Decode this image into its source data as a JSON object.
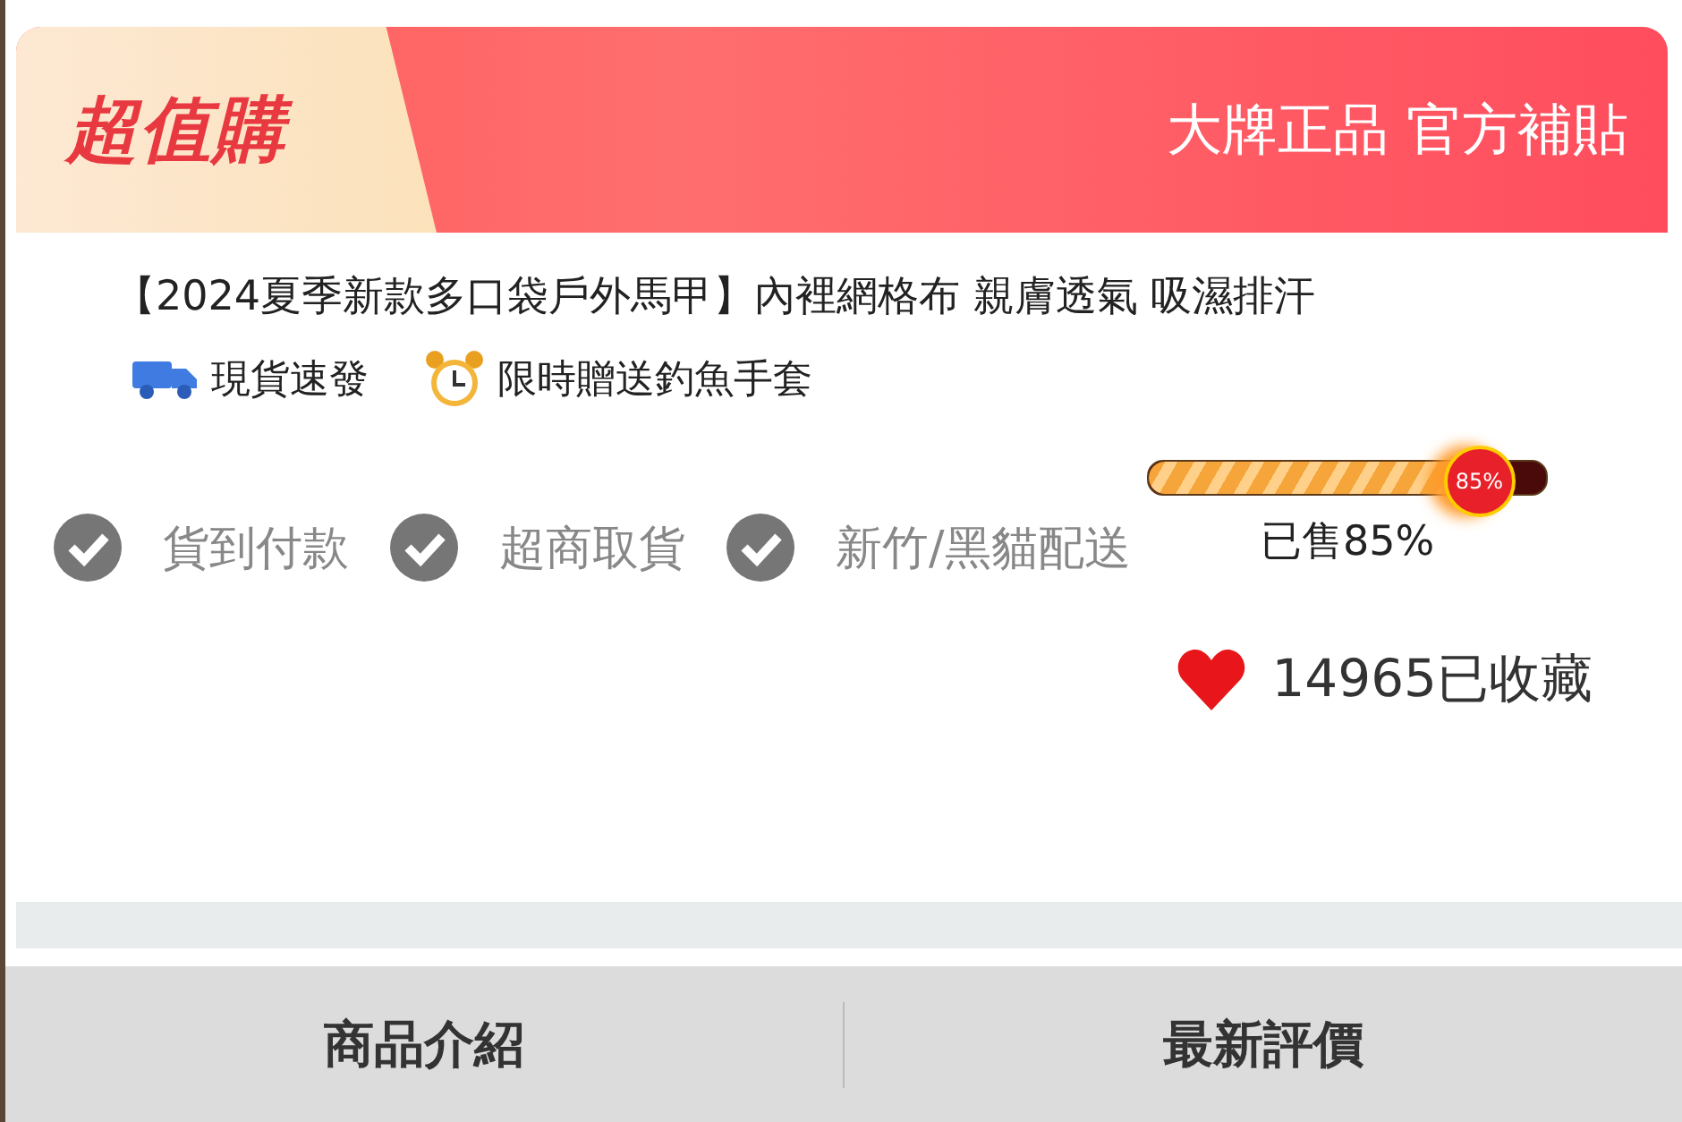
{
  "banner": {
    "logo": "超值購",
    "slogan": "大牌正品 官方補貼"
  },
  "product": {
    "title": "【2024夏季新款多口袋戶外馬甲】內裡網格布 親膚透氣 吸濕排汗",
    "tags": [
      {
        "kind": "truck",
        "label": "現貨速發"
      },
      {
        "kind": "clock",
        "label": "限時贈送釣魚手套"
      }
    ]
  },
  "sales": {
    "level": 0.85,
    "badge": "85%",
    "label": "已售85%"
  },
  "services": [
    {
      "label": "貨到付款",
      "checked": true
    },
    {
      "label": "超商取貨",
      "checked": true
    },
    {
      "label": "新竹/黑貓配送",
      "checked": true
    }
  ],
  "favorites": {
    "label": "14965已收藏"
  },
  "tabs": [
    {
      "label": "商品介紹"
    },
    {
      "label": "最新評價"
    }
  ]
}
